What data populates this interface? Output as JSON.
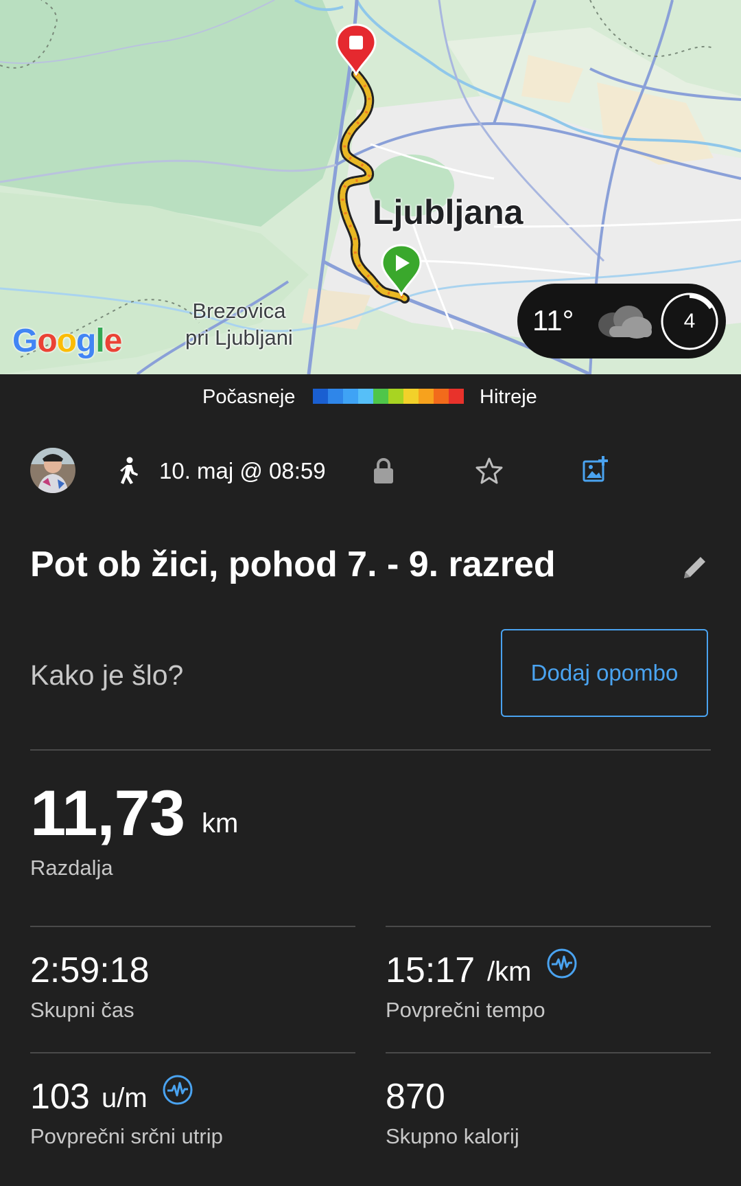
{
  "map": {
    "city_label": "Ljubljana",
    "town_label_line1": "Brezovica",
    "town_label_line2": "pri Ljubljani",
    "google_logo": "Google",
    "weather": {
      "temperature": "11°",
      "condition_icon": "cloud-icon",
      "uv_index": "4"
    }
  },
  "legend": {
    "slower_label": "Počasneje",
    "faster_label": "Hitreje",
    "colors": [
      "#1a5fd1",
      "#2f86e9",
      "#3fa3f5",
      "#56bff8",
      "#4fc64a",
      "#a8d422",
      "#f2d12a",
      "#f7a21d",
      "#f26b1b",
      "#e8322b"
    ]
  },
  "activity": {
    "activity_type_icon": "walking-icon",
    "date": "10. maj @ 08:59",
    "privacy_icon": "lock-icon",
    "favorite_icon": "star-icon",
    "add_photo_icon": "add-photo-icon",
    "title": "Pot ob žici, pohod 7. - 9. razred",
    "note_prompt": "Kako je šlo?",
    "add_note_button": "Dodaj opombo"
  },
  "stats": {
    "distance": {
      "value": "11,73",
      "unit": "km",
      "label": "Razdalja"
    },
    "total_time": {
      "value": "2:59:18",
      "label": "Skupni čas"
    },
    "avg_pace": {
      "value": "15:17",
      "unit": "/km",
      "label": "Povprečni tempo"
    },
    "avg_heart_rate": {
      "value": "103",
      "unit": "u/m",
      "label": "Povprečni srčni utrip"
    },
    "calories": {
      "value": "870",
      "label": "Skupno kalorij"
    }
  },
  "colors": {
    "background": "#202020",
    "accent": "#4aa3f0",
    "start_marker": "#3aa82c",
    "end_marker": "#e5292f"
  }
}
